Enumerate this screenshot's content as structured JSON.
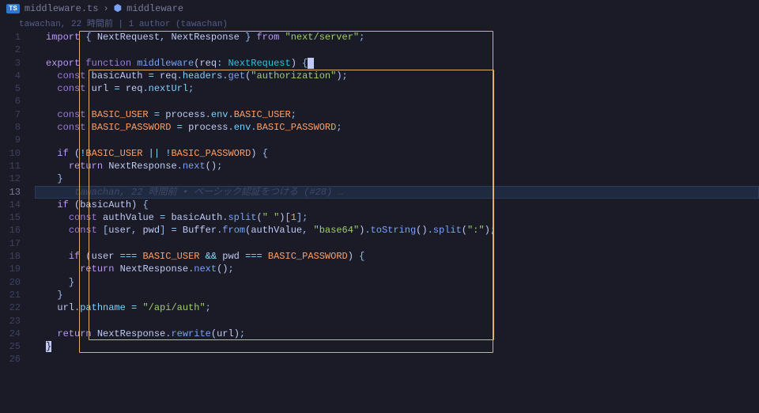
{
  "breadcrumb": {
    "ts_badge": "TS",
    "file": "middleware.ts",
    "sep": "›",
    "symbol": "middleware"
  },
  "subtitle": "tawachan, 22 時間前 | 1 author (tawachan)",
  "lens_line13": "     tawachan, 22 時間前 • ベーシック認証をつける (#28) …",
  "code": {
    "l1": "import { NextRequest, NextResponse } from \"next/server\";",
    "l2": "",
    "l3": "export function middleware(req: NextRequest) {",
    "l4": "  const basicAuth = req.headers.get(\"authorization\");",
    "l5": "  const url = req.nextUrl;",
    "l6": "",
    "l7": "  const BASIC_USER = process.env.BASIC_USER;",
    "l8": "  const BASIC_PASSWORD = process.env.BASIC_PASSWORD;",
    "l9": "",
    "l10": "  if (!BASIC_USER || !BASIC_PASSWORD) {",
    "l11": "    return NextResponse.next();",
    "l12": "  }",
    "l13": "",
    "l14": "  if (basicAuth) {",
    "l15": "    const authValue = basicAuth.split(\" \")[1];",
    "l16": "    const [user, pwd] = Buffer.from(authValue, \"base64\").toString().split(\":\");",
    "l17": "",
    "l18": "    if (user === BASIC_USER && pwd === BASIC_PASSWORD) {",
    "l19": "      return NextResponse.next();",
    "l20": "    }",
    "l21": "  }",
    "l22": "  url.pathname = \"/api/auth\";",
    "l23": "",
    "l24": "  return NextResponse.rewrite(url);",
    "l25": "}",
    "l26": ""
  },
  "line_numbers": [
    "1",
    "2",
    "3",
    "4",
    "5",
    "6",
    "7",
    "8",
    "9",
    "10",
    "11",
    "12",
    "13",
    "14",
    "15",
    "16",
    "17",
    "18",
    "19",
    "20",
    "21",
    "22",
    "23",
    "24",
    "25",
    "26"
  ],
  "current_line": 13
}
